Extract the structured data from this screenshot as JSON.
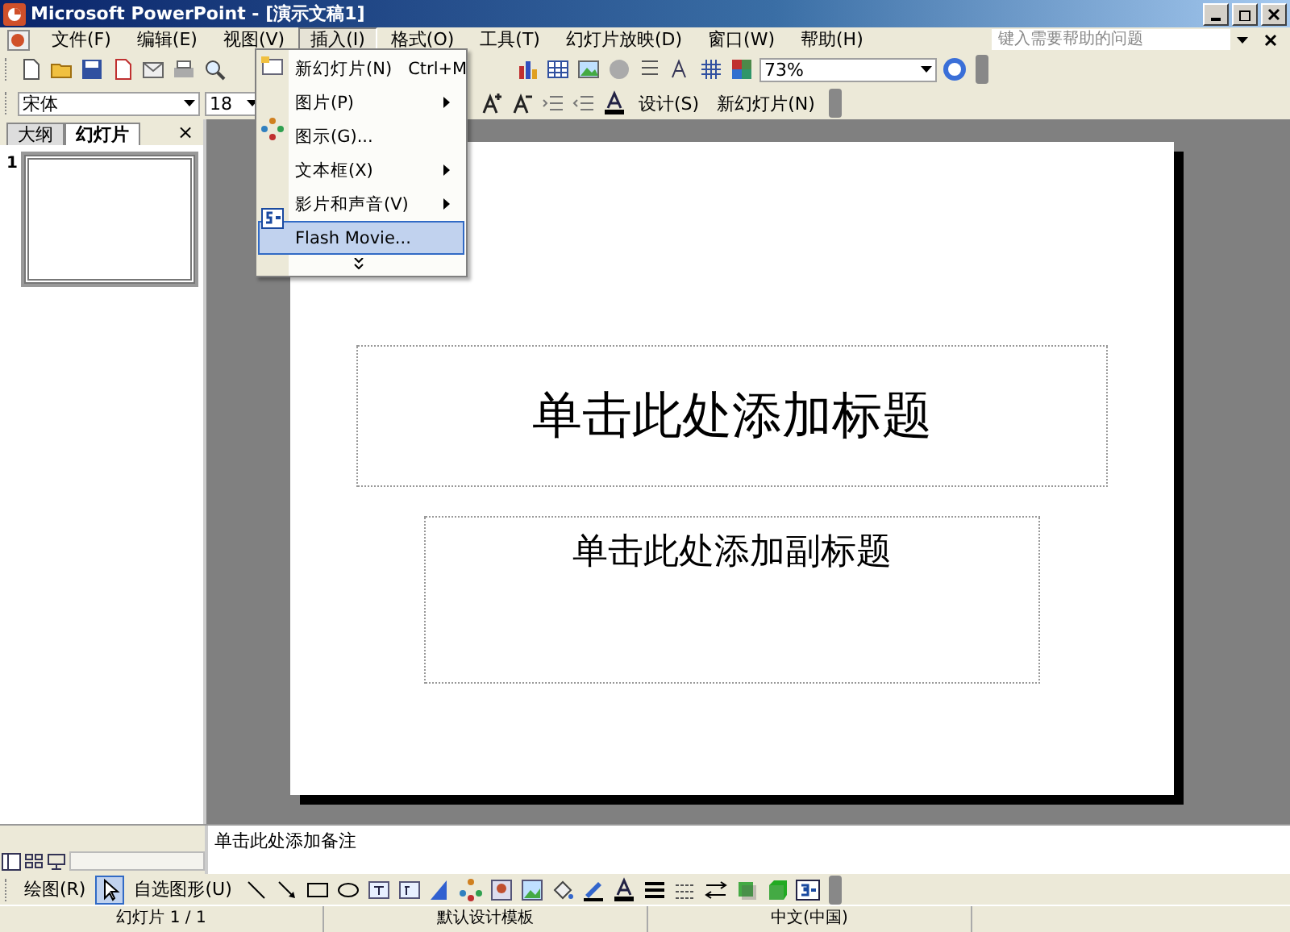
{
  "window": {
    "title": "Microsoft PowerPoint - [演示文稿1]"
  },
  "menu_bar": [
    {
      "label": "文件(F)",
      "selected": false
    },
    {
      "label": "编辑(E)",
      "selected": false
    },
    {
      "label": "视图(V)",
      "selected": false
    },
    {
      "label": "插入(I)",
      "selected": true
    },
    {
      "label": "格式(O)",
      "selected": false
    },
    {
      "label": "工具(T)",
      "selected": false
    },
    {
      "label": "幻灯片放映(D)",
      "selected": false
    },
    {
      "label": "窗口(W)",
      "selected": false
    },
    {
      "label": "帮助(H)",
      "selected": false
    }
  ],
  "help_box": {
    "placeholder": "键入需要帮助的问题"
  },
  "standard_toolbar": {
    "zoom": "73%"
  },
  "formatting_toolbar": {
    "font": "宋体",
    "size": "18",
    "design_button": "设计(S)",
    "new_slide_button": "新幻灯片(N)"
  },
  "insert_menu": [
    {
      "kind": "item",
      "label": "新幻灯片(N)",
      "shortcut": "Ctrl+M",
      "selected": false
    },
    {
      "kind": "submenu",
      "label": "图片(P)",
      "selected": false
    },
    {
      "kind": "item",
      "label": "图示(G)...",
      "selected": false
    },
    {
      "kind": "submenu",
      "label": "文本框(X)",
      "selected": false
    },
    {
      "kind": "submenu",
      "label": "影片和声音(V)",
      "selected": false
    },
    {
      "kind": "item",
      "label": "Flash Movie...",
      "selected": true
    }
  ],
  "side_panel": {
    "tabs": [
      {
        "label": "大纲",
        "selected": false
      },
      {
        "label": "幻灯片",
        "selected": true
      }
    ],
    "close": "×",
    "slides": [
      {
        "number": "1",
        "selected": true
      }
    ]
  },
  "slide": {
    "title_placeholder": "单击此处添加标题",
    "subtitle_placeholder": "单击此处添加副标题"
  },
  "notes": {
    "placeholder": "单击此处添加备注"
  },
  "drawing_toolbar": {
    "draw_menu": "绘图(R)",
    "autoshapes_menu": "自选图形(U)"
  },
  "status_bar": [
    "幻灯片 1 / 1",
    "默认设计模板",
    "中文(中国)"
  ]
}
